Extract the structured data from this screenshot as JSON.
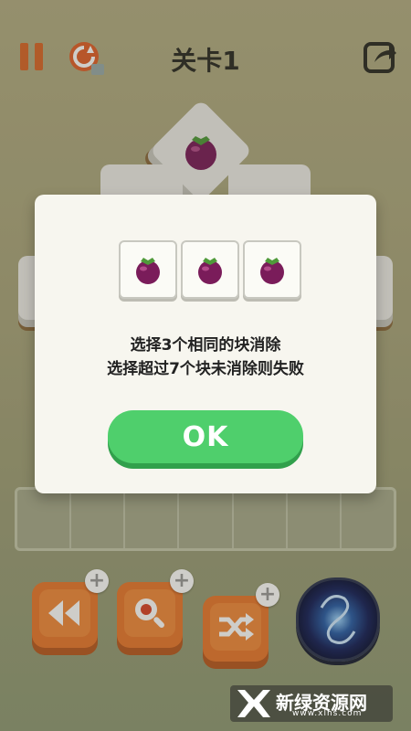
{
  "level": {
    "title": "关卡1"
  },
  "dialog": {
    "tile_icons": [
      "mangosteen-icon",
      "mangosteen-icon",
      "mangosteen-icon"
    ],
    "line1": "选择3个相同的块消除",
    "line2": "选择超过7个块未消除则失败",
    "ok_label": "OK"
  },
  "tray": {
    "slot_count": 7
  },
  "tools": {
    "undo": {
      "icon": "rewind-icon"
    },
    "hint": {
      "icon": "magnifier-icon"
    },
    "shuffle": {
      "icon": "shuffle-icon"
    },
    "vortex": {
      "icon": "vortex-icon"
    }
  },
  "watermark": {
    "title": "新绿资源网",
    "url": "www.xlhs.com"
  },
  "colors": {
    "accent_orange": "#e8782f",
    "ok_green": "#4fcf6c",
    "title_dark": "#2b2b24"
  }
}
